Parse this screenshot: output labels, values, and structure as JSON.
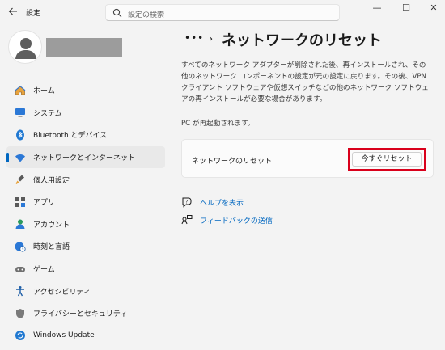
{
  "app": {
    "title": "設定",
    "back_icon": "back-arrow-icon"
  },
  "search": {
    "placeholder": "設定の検索"
  },
  "window_controls": {
    "minimize": "—",
    "maximize": "☐",
    "close": "✕"
  },
  "user": {
    "avatar_icon": "person-icon"
  },
  "nav": {
    "items": [
      {
        "label": "ホーム",
        "icon": "home-icon",
        "active": false
      },
      {
        "label": "システム",
        "icon": "monitor-icon",
        "active": false
      },
      {
        "label": "Bluetooth とデバイス",
        "icon": "bluetooth-icon",
        "active": false
      },
      {
        "label": "ネットワークとインターネット",
        "icon": "wifi-icon",
        "active": true
      },
      {
        "label": "個人用設定",
        "icon": "brush-icon",
        "active": false
      },
      {
        "label": "アプリ",
        "icon": "apps-icon",
        "active": false
      },
      {
        "label": "アカウント",
        "icon": "account-icon",
        "active": false
      },
      {
        "label": "時刻と言語",
        "icon": "globe-clock-icon",
        "active": false
      },
      {
        "label": "ゲーム",
        "icon": "gamepad-icon",
        "active": false
      },
      {
        "label": "アクセシビリティ",
        "icon": "accessibility-icon",
        "active": false
      },
      {
        "label": "プライバシーとセキュリティ",
        "icon": "shield-icon",
        "active": false
      },
      {
        "label": "Windows Update",
        "icon": "update-icon",
        "active": false
      }
    ]
  },
  "breadcrumb": {
    "dots": "•••",
    "chevron": "›"
  },
  "page": {
    "title": "ネットワークのリセット",
    "description": "すべてのネットワーク アダプターが削除された後、再インストールされ、その他のネットワーク コンポーネントの設定が元の設定に戻ります。その後、VPN クライアント ソフトウェアや仮想スイッチなどの他のネットワーク ソフトウェアの再インストールが必要な場合があります。",
    "restart_note": "PC が再起動されます。",
    "card_label": "ネットワークのリセット",
    "reset_button": "今すぐリセット",
    "help_link": "ヘルプを表示",
    "feedback_link": "フィードバックの送信"
  },
  "colors": {
    "accent": "#0067c0",
    "highlight": "#d9001b"
  }
}
